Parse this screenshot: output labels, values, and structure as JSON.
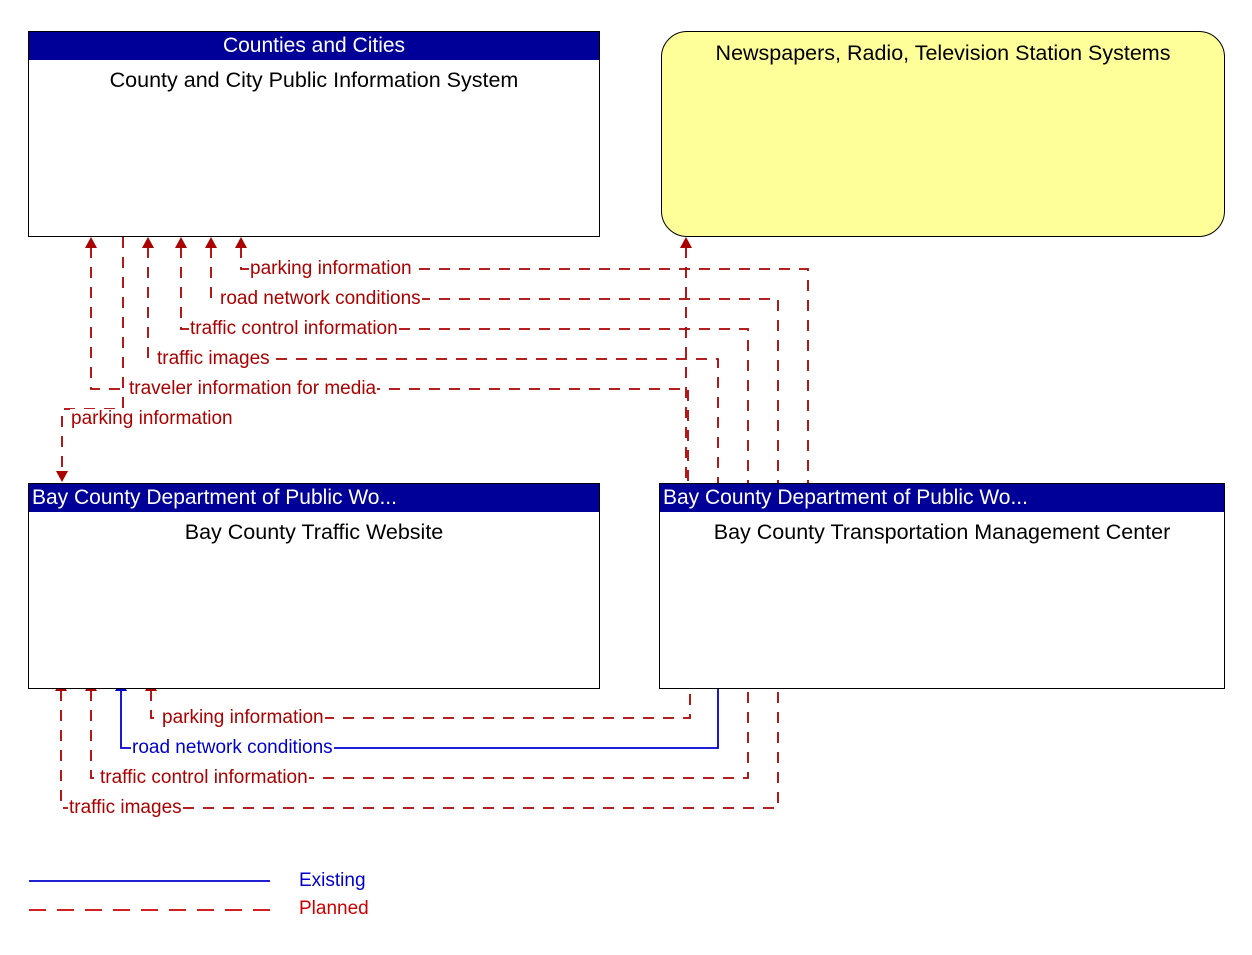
{
  "diagram": {
    "type": "interconnect-diagram",
    "colors": {
      "header_bar": "#000099",
      "header_text": "#ffffff",
      "terminator_fill": "#ffff99",
      "planned_flow": "#aa0000",
      "existing_flow": "#0000cc",
      "box_fill": "#ffffff",
      "box_border": "#000000"
    }
  },
  "nodes": {
    "county_city": {
      "stakeholder": "Counties and Cities",
      "name": "County and City Public Information System"
    },
    "media": {
      "name": "Newspapers, Radio, Television Station Systems"
    },
    "traffic_website": {
      "stakeholder": "Bay County Department of Public Wo...",
      "name": "Bay County Traffic Website"
    },
    "tmc": {
      "stakeholder": "Bay County Department of Public Wo...",
      "name": "Bay County Transportation Management Center"
    }
  },
  "flows": {
    "upper": [
      {
        "label": "parking information",
        "status": "Planned",
        "from": "tmc",
        "to": "county_city"
      },
      {
        "label": "road network conditions",
        "status": "Planned",
        "from": "tmc",
        "to": "county_city"
      },
      {
        "label": "traffic control information",
        "status": "Planned",
        "from": "tmc",
        "to": "county_city"
      },
      {
        "label": "traffic images",
        "status": "Planned",
        "from": "tmc",
        "to": "county_city"
      },
      {
        "label": "traveler information for media",
        "status": "Planned",
        "from": "tmc",
        "to": "county_city"
      }
    ],
    "media_flow": {
      "label": "traveler information for media",
      "status": "Planned",
      "from": "tmc",
      "to": "media"
    },
    "parking_down": {
      "label": "parking information",
      "status": "Planned",
      "from": "county_city",
      "to": "traffic_website"
    },
    "lower": [
      {
        "label": "parking information",
        "status": "Planned",
        "from": "tmc",
        "to": "traffic_website"
      },
      {
        "label": "road network conditions",
        "status": "Existing",
        "from": "tmc",
        "to": "traffic_website"
      },
      {
        "label": "traffic control information",
        "status": "Planned",
        "from": "tmc",
        "to": "traffic_website"
      },
      {
        "label": "traffic images",
        "status": "Planned",
        "from": "tmc",
        "to": "traffic_website"
      }
    ]
  },
  "legend": {
    "existing": "Existing",
    "planned": "Planned"
  }
}
